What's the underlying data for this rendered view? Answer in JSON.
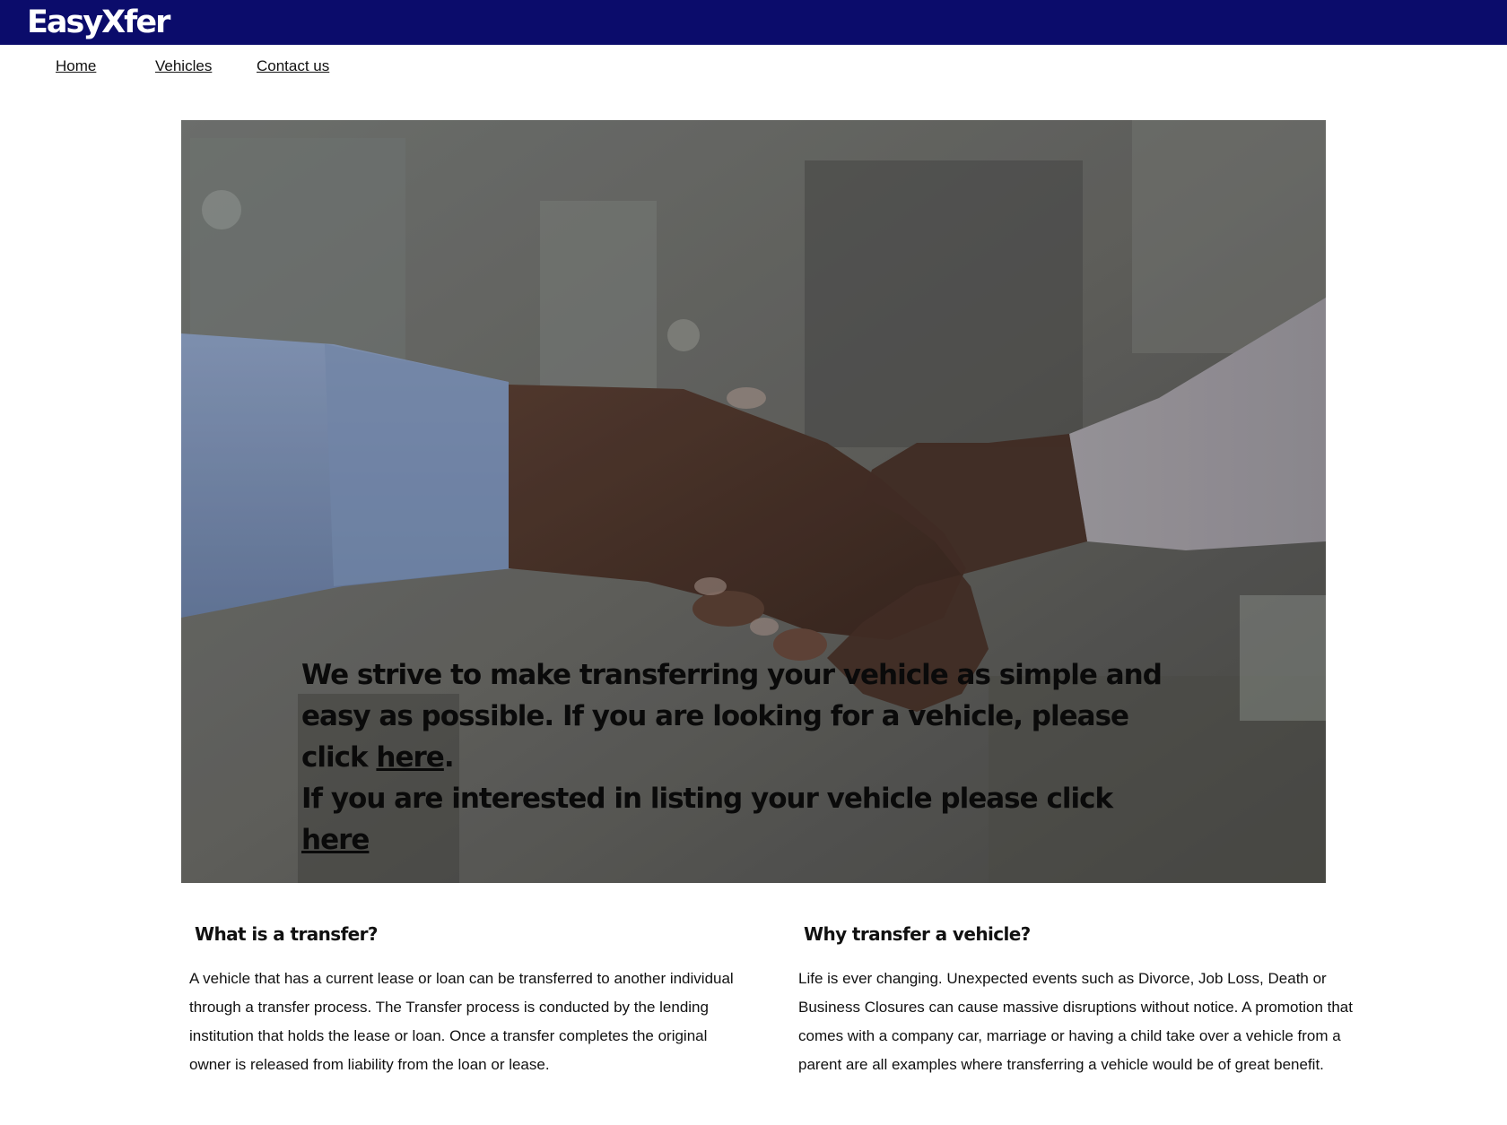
{
  "header": {
    "logo": "EasyXfer",
    "brand_color": "#0b0c6b"
  },
  "nav": {
    "items": [
      {
        "label": "Home"
      },
      {
        "label": "Vehicles"
      },
      {
        "label": "Contact us"
      }
    ]
  },
  "hero": {
    "image": "handshake-photo",
    "line1": "We strive to make transferring your vehicle as simple and easy as possible. If you are looking for a vehicle, please click ",
    "link1": "here",
    "after_link1": ".",
    "line2": "If you are interested in listing your vehicle please click ",
    "link2": "here"
  },
  "sections": [
    {
      "heading": "What is a transfer?",
      "body": "A vehicle that has a current lease or loan can be transferred to another individual through a transfer process. The Transfer process is conducted by the lending institution that holds the lease or loan. Once a transfer completes the original owner is released from liability from the loan or lease."
    },
    {
      "heading": "Why transfer a vehicle?",
      "body": "Life is ever changing. Unexpected events such as Divorce, Job Loss, Death or Business Closures can cause massive disruptions without notice. A promotion that comes with a company car, marriage or having a child take over a vehicle from a parent are all examples where transferring a vehicle would be of great benefit."
    }
  ]
}
